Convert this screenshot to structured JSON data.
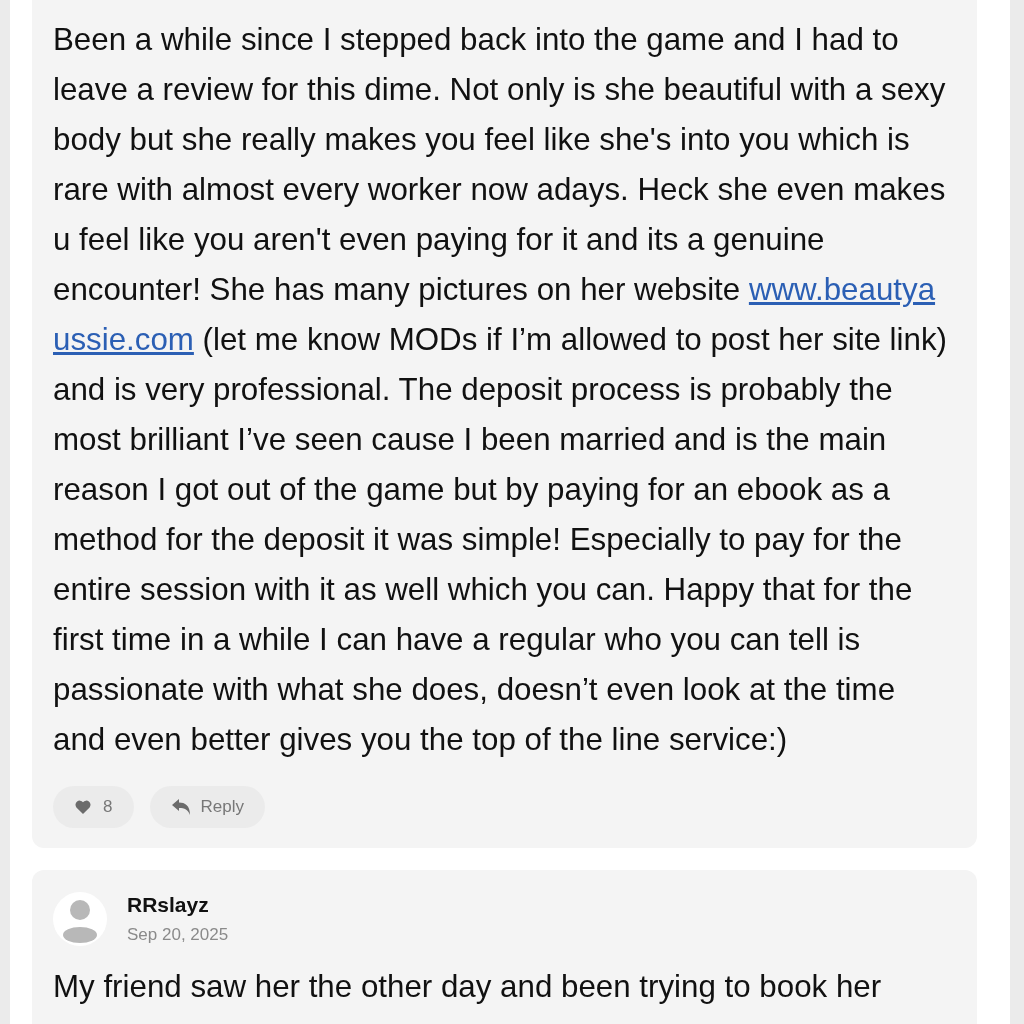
{
  "comments": [
    {
      "body": [
        {
          "kind": "text",
          "text": "Been a while since I stepped back into the game and I had to leave a review for this dime. Not only is she beautiful with a sexy body but she really makes you feel like she's into you which is rare with almost every worker now adays. Heck she even makes u feel like you aren't even paying for it and its a genuine encounter! She has many pictures on her website "
        },
        {
          "kind": "link",
          "text": "www.beautya"
        },
        {
          "kind": "link",
          "text": "ussie.com"
        },
        {
          "kind": "text",
          "text": " (let me know MODs if I’m allowed to post her site link) and is very professional. The deposit process is probably the most brilliant I’ve seen cause I been married and is the main reason I got out of the game but by paying for an ebook as a method for the deposit it was simple! Especially to pay for the entire session with it as well which you can. Happy that for the first time in a while I can have a regular who you can tell is passionate with what she does, doesn’t even look at the time and even better gives you the top of the line service:)"
        }
      ],
      "likes": "8",
      "reply_label": "Reply"
    },
    {
      "author": "RRslayz",
      "date": "Sep 20, 2025",
      "body": [
        {
          "kind": "text",
          "text": "My friend saw her the other day and been trying to book her"
        }
      ]
    }
  ]
}
